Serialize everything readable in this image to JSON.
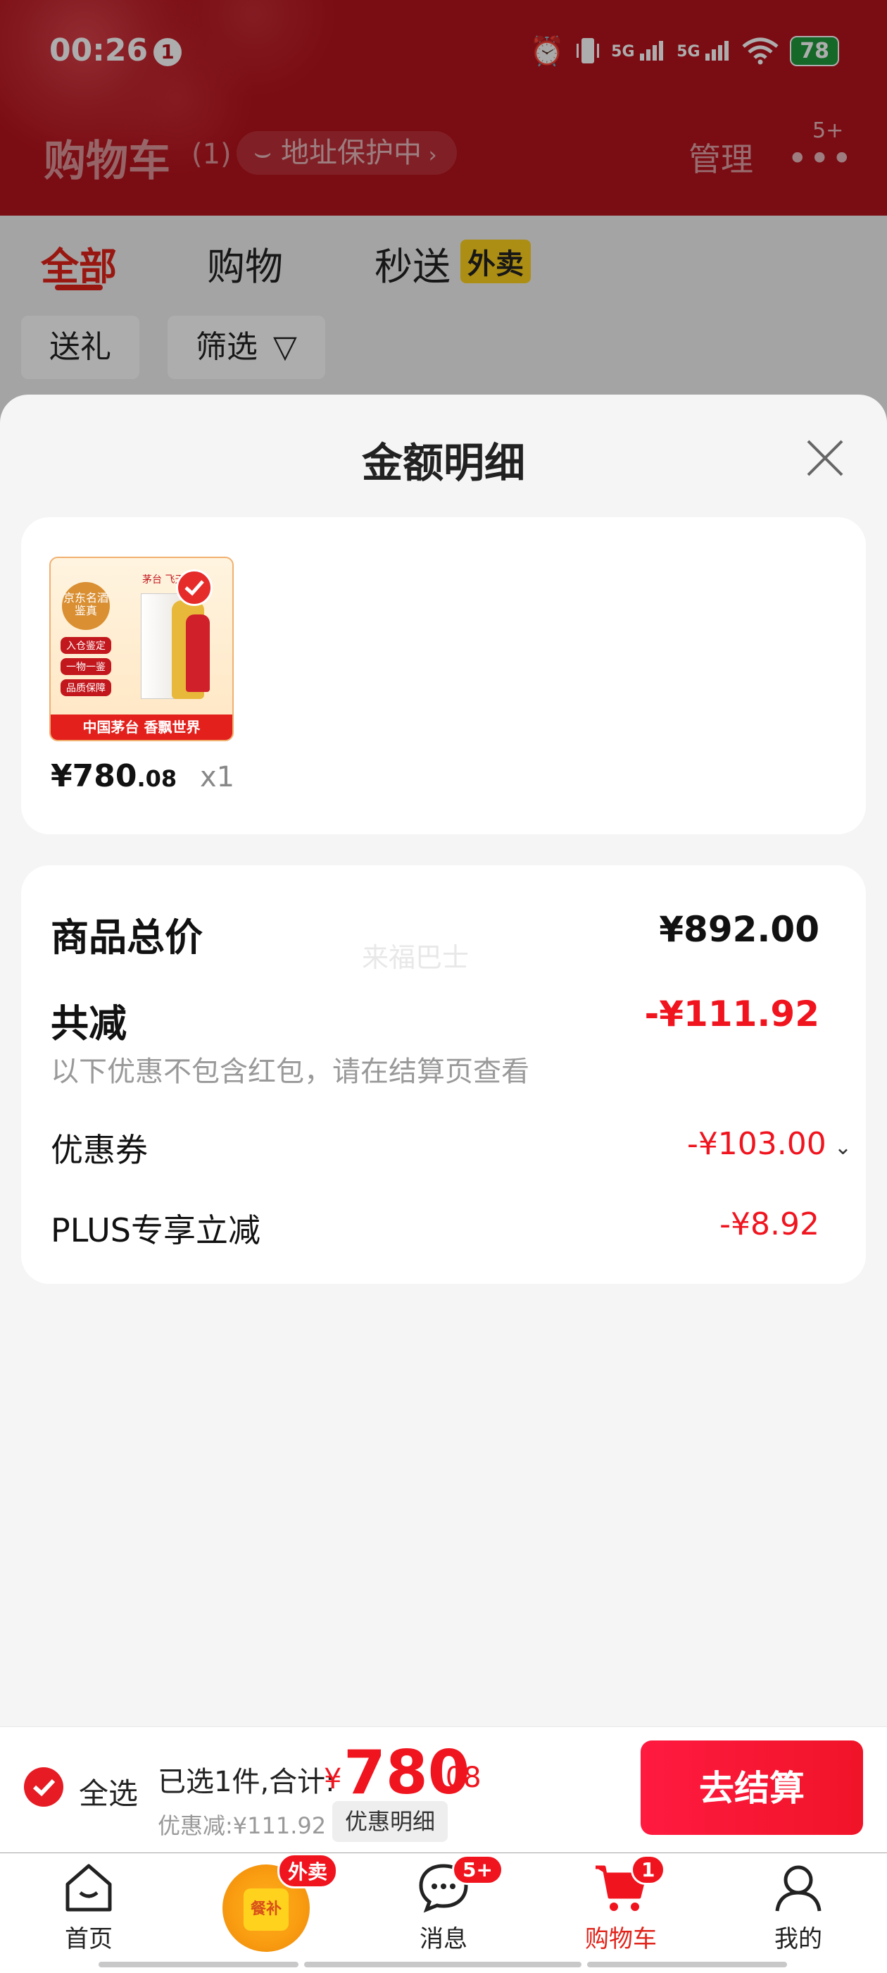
{
  "status_bar": {
    "time": "00:26",
    "notification_count": "1",
    "network_1": "5G",
    "network_2": "5G",
    "battery": "78",
    "icons": [
      "alarm-icon",
      "vibrate-icon",
      "signal-5g-icon",
      "signal-5g-icon",
      "wifi-icon",
      "battery-icon"
    ]
  },
  "header": {
    "title": "购物车",
    "count": "(1)",
    "address_pill": "地址保护中",
    "manage": "管理",
    "more_badge": "5+"
  },
  "tabs": [
    {
      "label": "全部",
      "active": true
    },
    {
      "label": "购物",
      "active": false
    },
    {
      "label": "秒送",
      "active": false,
      "tag": "外卖"
    }
  ],
  "filters": [
    {
      "label": "送礼"
    },
    {
      "label": "筛选"
    }
  ],
  "sheet": {
    "title": "金额明细",
    "product": {
      "image_texts": {
        "badge": "京东名酒鉴真",
        "tag1": "入仓鉴定",
        "tag2": "一物一鉴",
        "tag3": "品质保障",
        "brand": "茅台 飞天",
        "banner": "中国茅台 香飘世界"
      },
      "price_symbol": "¥",
      "price_int": "780",
      "price_dec": ".08",
      "quantity": "x1"
    },
    "breakdown": {
      "total_label": "商品总价",
      "total_value": "¥892.00",
      "watermark": "来福巴士",
      "reduce_label": "共减",
      "reduce_value": "-¥111.92",
      "reduce_note": "以下优惠不包含红包，请在结算页查看",
      "coupon_label": "优惠券",
      "coupon_value": "-¥103.00",
      "plus_label": "PLUS专享立减",
      "plus_value": "-¥8.92"
    }
  },
  "checkout": {
    "select_all": "全选",
    "summary": "已选1件,合计:",
    "total_symbol": "¥",
    "total_int": "780",
    "total_dec": ".08",
    "discount": "优惠减:¥111.92",
    "detail_button": "优惠明细",
    "pay_button": "去结算"
  },
  "tab_bar": [
    {
      "label": "首页",
      "icon": "home-icon"
    },
    {
      "label": "",
      "icon": "meal-allowance-icon",
      "badge": "外卖",
      "icon_text": "餐补"
    },
    {
      "label": "消息",
      "icon": "message-icon",
      "badge": "5+"
    },
    {
      "label": "购物车",
      "icon": "cart-icon",
      "badge": "1",
      "active": true
    },
    {
      "label": "我的",
      "icon": "profile-icon"
    }
  ],
  "colors": {
    "brand_red": "#e2231a",
    "price_red": "#f0141e",
    "header_red": "#b4131c",
    "takeout_yellow": "#ffd21e"
  }
}
